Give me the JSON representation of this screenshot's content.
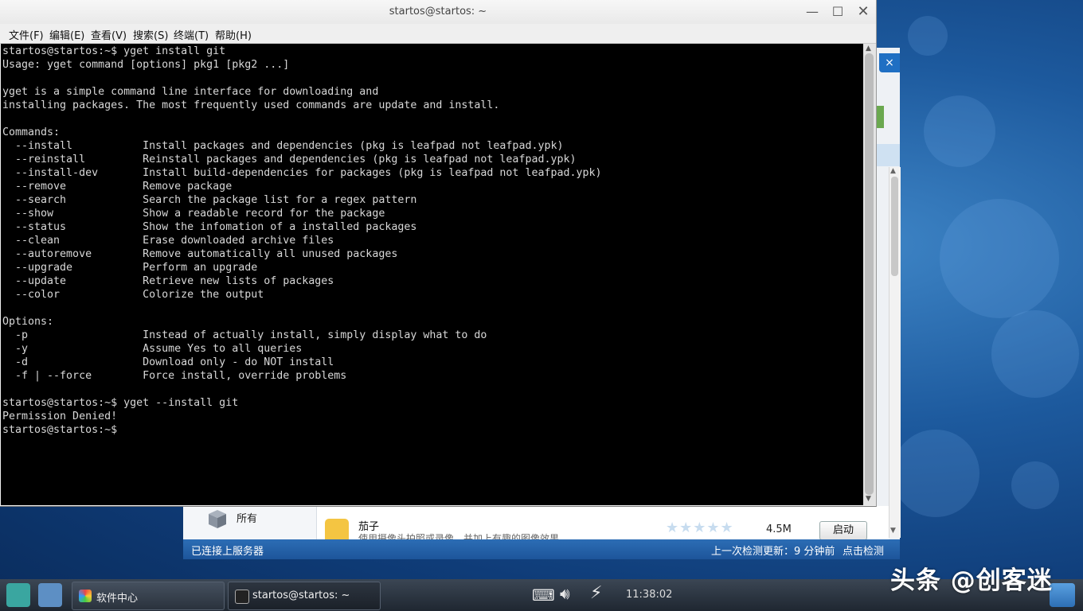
{
  "terminal": {
    "title": "startos@startos: ~",
    "menu": [
      "文件(F)",
      "编辑(E)",
      "查看(V)",
      "搜索(S)",
      "终端(T)",
      "帮助(H)"
    ],
    "output": "startos@startos:~$ yget install git\nUsage: yget command [options] pkg1 [pkg2 ...]\n\nyget is a simple command line interface for downloading and\ninstalling packages. The most frequently used commands are update and install.\n\nCommands:\n  --install           Install packages and dependencies (pkg is leafpad not leafpad.ypk)\n  --reinstall         Reinstall packages and dependencies (pkg is leafpad not leafpad.ypk)\n  --install-dev       Install build-dependencies for packages (pkg is leafpad not leafpad.ypk)\n  --remove            Remove package\n  --search            Search the package list for a regex pattern\n  --show              Show a readable record for the package\n  --status            Show the infomation of a installed packages\n  --clean             Erase downloaded archive files\n  --autoremove        Remove automatically all unused packages\n  --upgrade           Perform an upgrade\n  --update            Retrieve new lists of packages\n  --color             Colorize the output\n\nOptions:\n  -p                  Instead of actually install, simply display what to do\n  -y                  Assume Yes to all queries\n  -d                  Download only - do NOT install\n  -f | --force        Force install, override problems\n\nstartos@startos:~$ yget --install git\nPermission Denied!\nstartos@startos:~$ "
  },
  "software_center": {
    "close_glyph": "×",
    "category": "所有",
    "app": {
      "name": "茄子",
      "description": "使用摄像头拍照或录像，并加上有趣的图像效果",
      "rating_stars": "★★★★★",
      "size": "4.5M",
      "launch_label": "启动"
    },
    "status": {
      "connected": "已连接上服务器",
      "last_check": "上一次检测更新：9 分钟前",
      "check_link": "点击检测"
    }
  },
  "taskbar": {
    "tasks": [
      {
        "label": "软件中心"
      },
      {
        "label": "startos@startos: ~"
      }
    ],
    "clock": "11:38:02"
  },
  "watermark": "头条 @创客迷",
  "colors": {
    "terminal_bg": "#000000",
    "terminal_fg": "#d8d8d8",
    "status_bar": "#2c6db5",
    "taskbar": "#2a323d"
  }
}
